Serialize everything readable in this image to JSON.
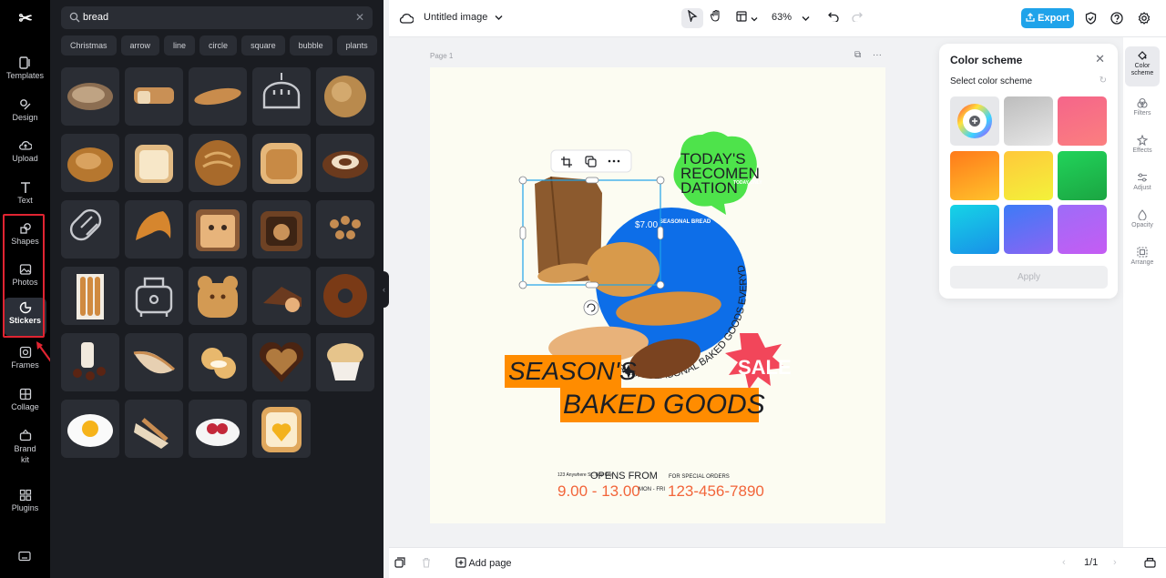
{
  "nav": {
    "logo": "✂",
    "items": [
      {
        "label": "Templates",
        "icon": "templates-icon"
      },
      {
        "label": "Design",
        "icon": "design-icon"
      },
      {
        "label": "Upload",
        "icon": "upload-icon"
      },
      {
        "label": "Text",
        "icon": "text-icon"
      },
      {
        "label": "Shapes",
        "icon": "shapes-icon"
      },
      {
        "label": "Photos",
        "icon": "photos-icon"
      },
      {
        "label": "Stickers",
        "icon": "stickers-icon"
      },
      {
        "label": "Frames",
        "icon": "frames-icon"
      },
      {
        "label": "Collage",
        "icon": "collage-icon"
      },
      {
        "label": "Brand kit",
        "icon": "brand-kit-icon"
      },
      {
        "label": "Plugins",
        "icon": "plugins-icon"
      }
    ],
    "active": "Stickers",
    "highlight_color": "#e02431"
  },
  "panel": {
    "search_value": "bread",
    "chips": [
      "Christmas",
      "arrow",
      "line",
      "circle",
      "square",
      "bubble",
      "plants"
    ]
  },
  "topbar": {
    "doc_title": "Untitled image",
    "zoom": "63%",
    "export_label": "Export",
    "accent": "#1fa3ea"
  },
  "canvas": {
    "page_label": "Page 1",
    "poster": {
      "bubble_lines": [
        "TODAY'S",
        "RECOMEN",
        "DATION"
      ],
      "bubble_small": "TODAY ONLY",
      "price": "$7.00",
      "price_sub": "SEASONAL BREAD",
      "headline_1": "SEASON'S",
      "headline_2": "BAKED GOODS",
      "circle_text": "FRESH SEASONAL BAKED GOODS EVERYDAY",
      "sale": "SALE",
      "address": "123 Anywhere St., Any City",
      "opens_label": "OPENS FROM",
      "hours": "9.00 - 13.00",
      "days": "MON - FRI",
      "orders_label": "FOR SPECIAL ORDERS",
      "phone": "123-456-7890"
    }
  },
  "bottombar": {
    "add_page": "Add page",
    "page_count": "1/1"
  },
  "rightstrip": [
    {
      "label": "Color scheme",
      "icon": "paint-bucket-icon"
    },
    {
      "label": "Filters",
      "icon": "filters-icon"
    },
    {
      "label": "Effects",
      "icon": "effects-icon"
    },
    {
      "label": "Adjust",
      "icon": "adjust-icon"
    },
    {
      "label": "Opacity",
      "icon": "opacity-icon"
    },
    {
      "label": "Arrange",
      "icon": "arrange-icon"
    }
  ],
  "color_panel": {
    "title": "Color scheme",
    "subtitle": "Select color scheme",
    "apply": "Apply",
    "swatches": [
      {
        "name": "custom-wheel",
        "from": "#ffffff",
        "to": "#ffffff"
      },
      {
        "name": "gray",
        "from": "#bdbdbd",
        "to": "#e6e6e6"
      },
      {
        "name": "pink",
        "from": "#f5658a",
        "to": "#fb7f7f"
      },
      {
        "name": "orange",
        "from": "#ff7a1a",
        "to": "#ffc22b"
      },
      {
        "name": "yellow",
        "from": "#ffc83a",
        "to": "#f3f23a"
      },
      {
        "name": "green",
        "from": "#21d35a",
        "to": "#1ba542"
      },
      {
        "name": "cyan",
        "from": "#16d4e6",
        "to": "#1890e8"
      },
      {
        "name": "blue",
        "from": "#3d7bf6",
        "to": "#8a64f4"
      },
      {
        "name": "purple",
        "from": "#9d6cf8",
        "to": "#c55cf3"
      }
    ]
  }
}
